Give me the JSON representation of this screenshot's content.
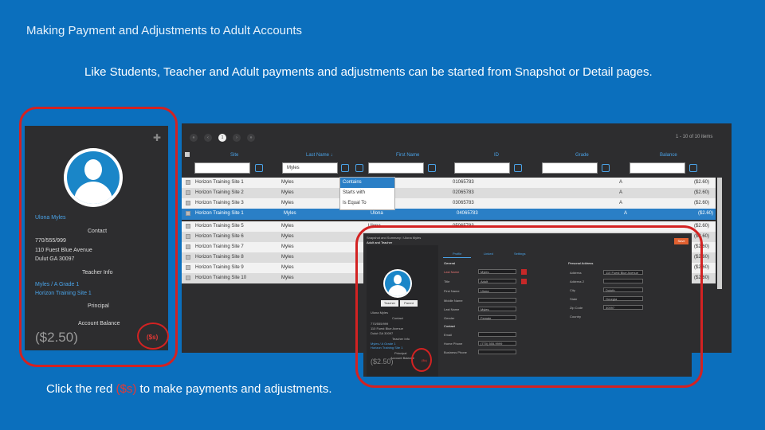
{
  "slide": {
    "title": "Making Payment and Adjustments to Adult Accounts",
    "subtitle": "Like Students, Teacher and Adult payments and adjustments can be started from Snapshot or Detail pages.",
    "footer_prefix": "Click the red ",
    "footer_red": "($s)",
    "footer_suffix": " to make payments and adjustments."
  },
  "colors": {
    "background": "#0b6fbd",
    "panel": "#2d2d2f",
    "accent_red": "#d32222",
    "link_blue": "#4aa3e8"
  },
  "snapshot": {
    "plus_icon": "plus-icon",
    "name": "Ulona Myles",
    "contact_label": "Contact",
    "phone": "770/555/999",
    "address1": "110 Fuest Blue Avenue",
    "address2": "Dulut GA 30097",
    "teacher_info_label": "Teacher Info",
    "teacher_link": "Myles / A Grade 1",
    "site_link": "Horizon Training Site 1",
    "principal": "Principal",
    "account_balance_label": "Account Balance",
    "balance": "($2.50)",
    "payment_button": "($s)"
  },
  "grid": {
    "pages": [
      "«",
      "‹",
      "1",
      "›",
      "»"
    ],
    "items_text": "1 - 10 of 10 items",
    "columns": [
      "Site",
      "Last Name ↓",
      "First Name",
      "ID",
      "Grade",
      "Balance"
    ],
    "filter_value": "Myles",
    "filter_menu": [
      "Contains",
      "Starts with",
      "Is Equal To"
    ],
    "rows": [
      [
        "Horizon Training Site 1",
        "Myles",
        "",
        "01065783",
        "A",
        "($2.60)"
      ],
      [
        "Horizon Training Site 2",
        "Myles",
        "",
        "02065783",
        "A",
        "($2.60)"
      ],
      [
        "Horizon Training Site 3",
        "Myles",
        "",
        "03065783",
        "A",
        "($2.60)"
      ],
      [
        "Horizon Training Site 1",
        "Myles",
        "Ulona",
        "04065783",
        "A",
        "($2.60)"
      ],
      [
        "Horizon Training Site 5",
        "Myles",
        "Ulona",
        "05065783",
        "A",
        "($2.60)"
      ],
      [
        "Horizon Training Site 6",
        "Myles",
        "",
        "",
        "",
        "($2.60)"
      ],
      [
        "Horizon Training Site 7",
        "Myles",
        "",
        "",
        "",
        "($2.60)"
      ],
      [
        "Horizon Training Site 8",
        "Myles",
        "",
        "",
        "",
        "($2.60)"
      ],
      [
        "Horizon Training Site 9",
        "Myles",
        "",
        "",
        "",
        "($2.60)"
      ],
      [
        "Horizon Training Site 10",
        "Myles",
        "",
        "",
        "",
        "($2.60)"
      ]
    ]
  },
  "detail": {
    "breadcrumb": "Snapshot and Summary / Ulona Myles",
    "subheading": "Adult and Teacher",
    "tabs": [
      "Profile",
      "Linked",
      "Settings"
    ],
    "save_label": "Save",
    "section_general": "General",
    "section_personal": "Personal Address",
    "left_labels": [
      "Last Name",
      "Title",
      "First Name",
      "Middle Name",
      "Last Name",
      "Gender"
    ],
    "left_values": [
      "Myles",
      "Adult",
      "Ulona",
      "",
      "Myles",
      "Female"
    ],
    "right_labels": [
      "Address",
      "Address 2",
      "City",
      "State",
      "Zip Code",
      "Country"
    ],
    "right_values": [
      "110 Fuest Blue Avenue",
      "",
      "Duluth",
      "Georgia",
      "30097",
      ""
    ],
    "contact_label": "Contact",
    "contact_fields": [
      "Email",
      "Home Phone",
      "Business Phone"
    ],
    "phone_value": "(770) 555-9999",
    "button_teacher": "Teacher",
    "button_parent": "Parent",
    "info_lines": [
      "Ulona Myles",
      "Contact",
      "770/555/999",
      "110 Fuest Blue Avenue",
      "Dulut GA 30097",
      "Teacher Info",
      "Myles / A Grade 1",
      "Horizon Training Site 1",
      "Principal",
      "Account Balance"
    ],
    "balance": "($2.50)",
    "payment_button": "($s)"
  }
}
